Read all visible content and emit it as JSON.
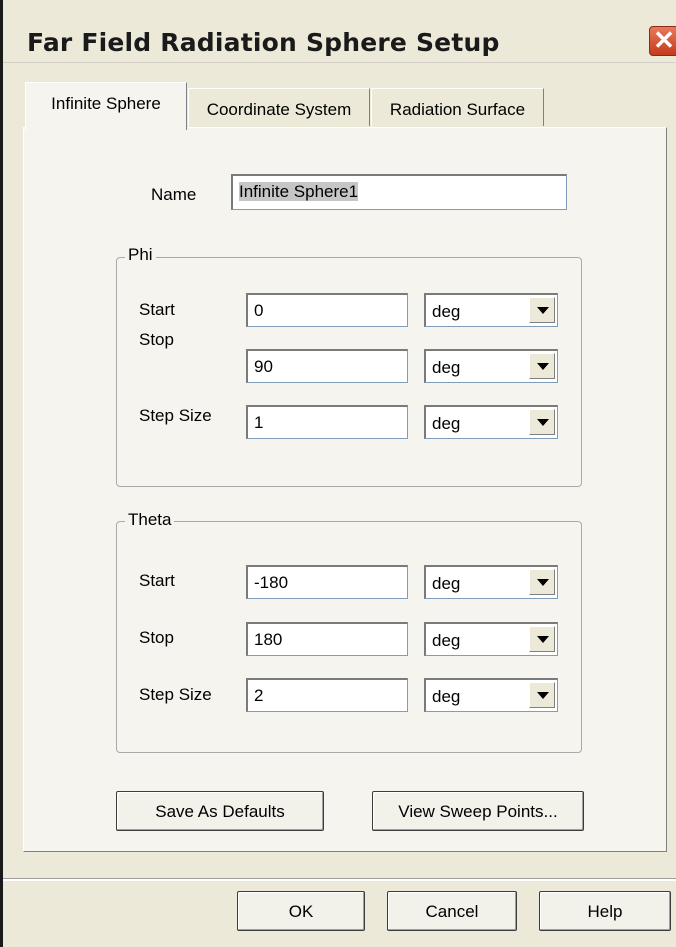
{
  "window": {
    "title": "Far Field Radiation Sphere Setup",
    "close_glyph": "✕"
  },
  "tabs": [
    {
      "label": "Infinite Sphere",
      "active": true
    },
    {
      "label": "Coordinate System",
      "active": false
    },
    {
      "label": "Radiation Surface",
      "active": false
    }
  ],
  "name": {
    "label": "Name",
    "value": "Infinite Sphere1"
  },
  "phi": {
    "title": "Phi",
    "start": {
      "label": "Start",
      "value": "0",
      "unit": "deg"
    },
    "stop": {
      "label": "Stop",
      "value": "90",
      "unit": "deg"
    },
    "step": {
      "label": "Step Size",
      "value": "1",
      "unit": "deg"
    }
  },
  "theta": {
    "title": "Theta",
    "start": {
      "label": "Start",
      "value": "-180",
      "unit": "deg"
    },
    "stop": {
      "label": "Stop",
      "value": "180",
      "unit": "deg"
    },
    "step": {
      "label": "Step Size",
      "value": "2",
      "unit": "deg"
    }
  },
  "buttons": {
    "save_defaults": "Save As Defaults",
    "view_sweep": "View Sweep Points...",
    "ok": "OK",
    "cancel": "Cancel",
    "help": "Help"
  },
  "colors": {
    "dialog_bg": "#ece9d8",
    "close_red": "#c33a1b"
  },
  "icons": {
    "close": "close-icon",
    "dropdown": "chevron-down-icon"
  }
}
